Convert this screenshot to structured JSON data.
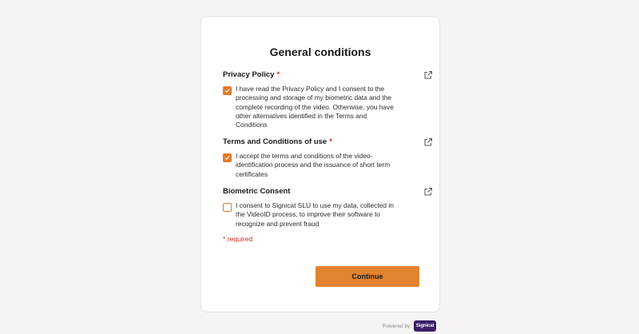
{
  "title": "General conditions",
  "required_marker": "*",
  "sections": [
    {
      "heading": "Privacy Policy",
      "required": true,
      "checked": true,
      "text": "I have read the Privacy Policy and I consent to the processing and storage of my biometric data and the complete recording of the video. Otherwise, you have other alternatives identified in the Terms and Conditions",
      "link_icon": "external-link-icon"
    },
    {
      "heading": "Terms and Conditions of use",
      "required": true,
      "checked": true,
      "text": "I accept the terms and conditions of the video-identification process and the issuance of short term certificates",
      "link_icon": "external-link-icon"
    },
    {
      "heading": "Biometric Consent",
      "required": false,
      "checked": false,
      "text": "I consent to Signicat SLU to use my data, collected in the VideoID process, to improve their software to recognize and prevent fraud",
      "link_icon": "external-link-icon"
    }
  ],
  "required_note": "* required",
  "continue_label": "Continue",
  "footer": {
    "powered_by": "Powered by:",
    "brand": "Signicat"
  },
  "colors": {
    "accent": "#e2832f",
    "required": "#d32d1f",
    "brand": "#3b1d69",
    "background": "#f5f4f3"
  }
}
